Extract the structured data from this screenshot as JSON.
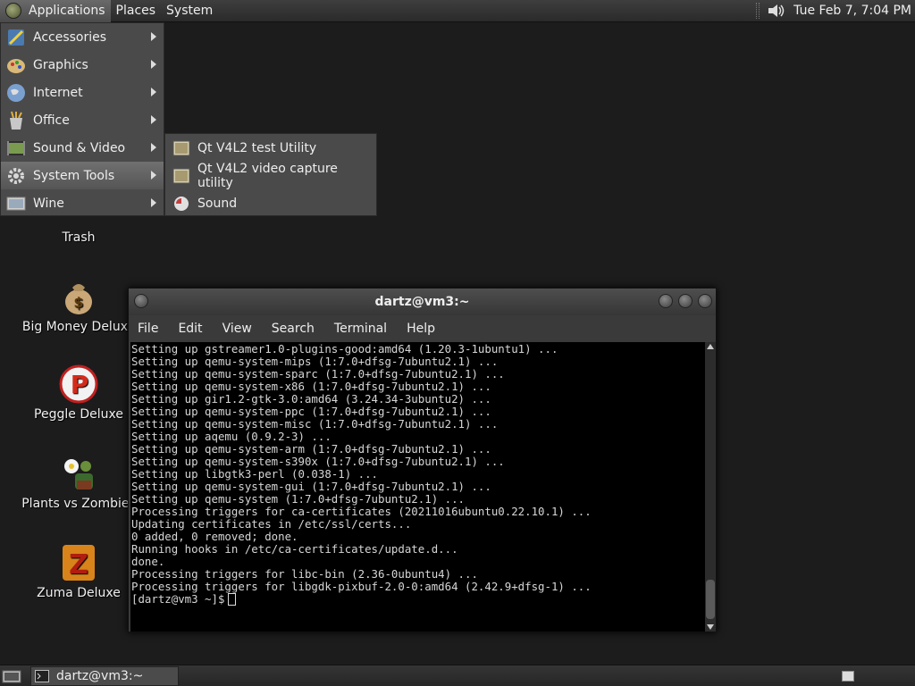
{
  "top_panel": {
    "menus": [
      "Applications",
      "Places",
      "System"
    ],
    "clock": "Tue Feb  7, 7:04 PM"
  },
  "app_menu": {
    "items": [
      {
        "label": "Accessories",
        "icon": "accessories-icon"
      },
      {
        "label": "Graphics",
        "icon": "graphics-icon"
      },
      {
        "label": "Internet",
        "icon": "internet-icon"
      },
      {
        "label": "Office",
        "icon": "office-icon"
      },
      {
        "label": "Sound & Video",
        "icon": "sound-video-icon"
      },
      {
        "label": "System Tools",
        "icon": "system-tools-icon"
      },
      {
        "label": "Wine",
        "icon": "wine-icon"
      }
    ],
    "highlighted": "System Tools",
    "submenu": [
      {
        "label": "Qt V4L2 test Utility",
        "icon": "qt-app-icon"
      },
      {
        "label": "Qt V4L2 video capture utility",
        "icon": "qt-app-icon"
      },
      {
        "label": "Sound",
        "icon": "sound-icon"
      }
    ]
  },
  "desktop_icons": [
    {
      "label": "Trash",
      "icon": "trash-icon"
    },
    {
      "label": "Big Money Deluxe",
      "icon": "money-bag-icon"
    },
    {
      "label": "Peggle Deluxe",
      "icon": "peggle-icon"
    },
    {
      "label": "Plants vs Zombies",
      "icon": "plants-icon"
    },
    {
      "label": "Zuma Deluxe",
      "icon": "zuma-icon"
    }
  ],
  "terminal": {
    "title": "dartz@vm3:~",
    "menus": [
      "File",
      "Edit",
      "View",
      "Search",
      "Terminal",
      "Help"
    ],
    "lines": [
      "Setting up gstreamer1.0-plugins-good:amd64 (1.20.3-1ubuntu1) ...",
      "Setting up qemu-system-mips (1:7.0+dfsg-7ubuntu2.1) ...",
      "Setting up qemu-system-sparc (1:7.0+dfsg-7ubuntu2.1) ...",
      "Setting up qemu-system-x86 (1:7.0+dfsg-7ubuntu2.1) ...",
      "Setting up gir1.2-gtk-3.0:amd64 (3.24.34-3ubuntu2) ...",
      "Setting up qemu-system-ppc (1:7.0+dfsg-7ubuntu2.1) ...",
      "Setting up qemu-system-misc (1:7.0+dfsg-7ubuntu2.1) ...",
      "Setting up aqemu (0.9.2-3) ...",
      "Setting up qemu-system-arm (1:7.0+dfsg-7ubuntu2.1) ...",
      "Setting up qemu-system-s390x (1:7.0+dfsg-7ubuntu2.1) ...",
      "Setting up libgtk3-perl (0.038-1) ...",
      "Setting up qemu-system-gui (1:7.0+dfsg-7ubuntu2.1) ...",
      "Setting up qemu-system (1:7.0+dfsg-7ubuntu2.1) ...",
      "Processing triggers for ca-certificates (20211016ubuntu0.22.10.1) ...",
      "Updating certificates in /etc/ssl/certs...",
      "0 added, 0 removed; done.",
      "Running hooks in /etc/ca-certificates/update.d...",
      "done.",
      "Processing triggers for libc-bin (2.36-0ubuntu4) ...",
      "Processing triggers for libgdk-pixbuf-2.0-0:amd64 (2.42.9+dfsg-1) ..."
    ],
    "prompt": "[dartz@vm3 ~]$"
  },
  "bottom_panel": {
    "task": "dartz@vm3:~"
  }
}
